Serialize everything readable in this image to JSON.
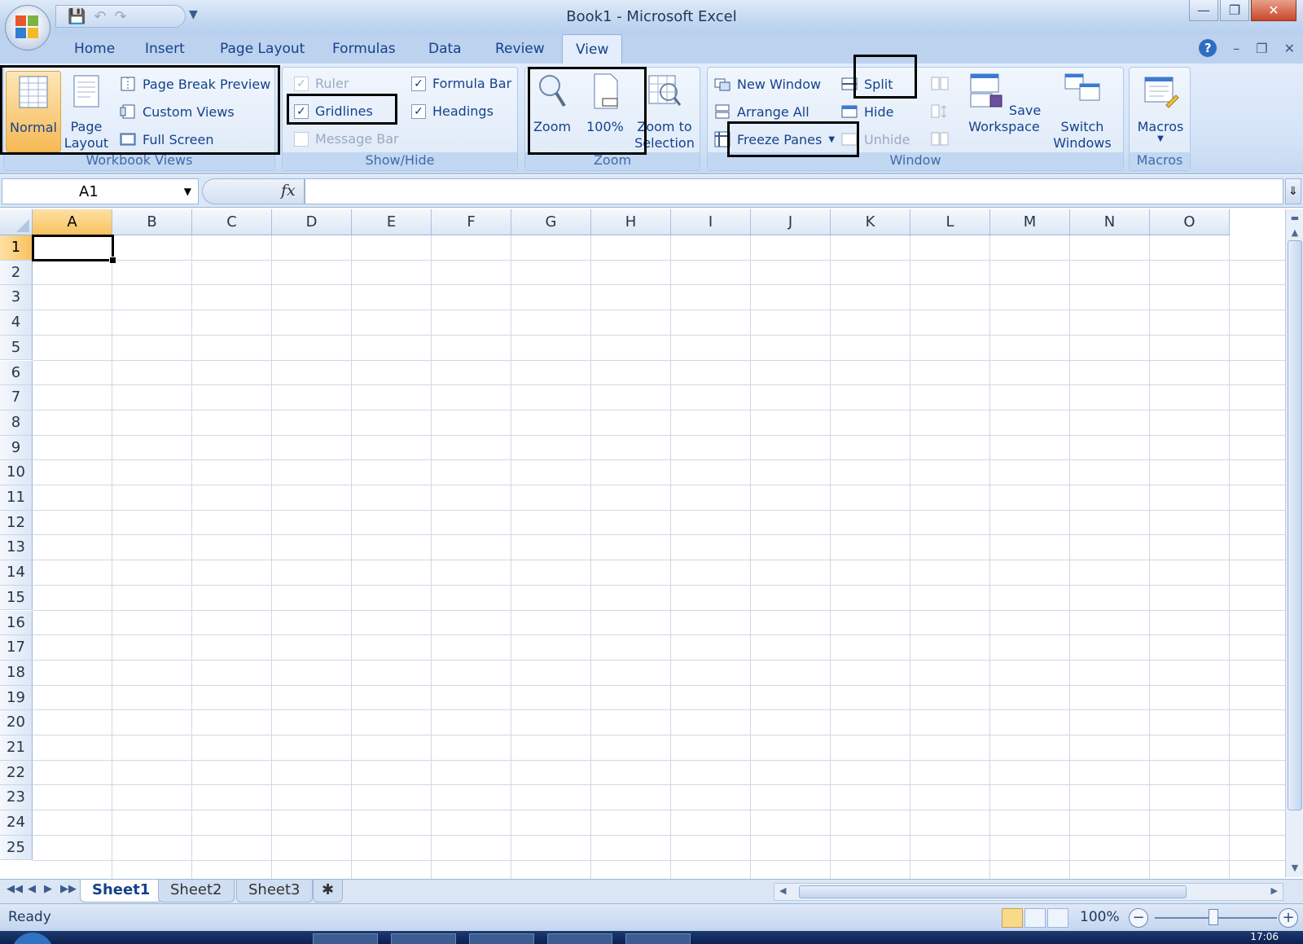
{
  "title": "Book1 - Microsoft Excel",
  "tabs": [
    {
      "label": "Home",
      "active": false
    },
    {
      "label": "Insert",
      "active": false
    },
    {
      "label": "Page Layout",
      "active": false
    },
    {
      "label": "Formulas",
      "active": false
    },
    {
      "label": "Data",
      "active": false
    },
    {
      "label": "Review",
      "active": false
    },
    {
      "label": "View",
      "active": true
    }
  ],
  "ribbon": {
    "workbook_views": {
      "label": "Workbook Views",
      "normal": "Normal",
      "page_layout": "Page\nLayout",
      "page_break_preview": "Page Break Preview",
      "custom_views": "Custom Views",
      "full_screen": "Full Screen"
    },
    "show_hide": {
      "label": "Show/Hide",
      "ruler": {
        "label": "Ruler",
        "checked": true,
        "enabled": false
      },
      "gridlines": {
        "label": "Gridlines",
        "checked": true,
        "enabled": true
      },
      "message_bar": {
        "label": "Message Bar",
        "checked": false,
        "enabled": false
      },
      "formula_bar": {
        "label": "Formula Bar",
        "checked": true,
        "enabled": true
      },
      "headings": {
        "label": "Headings",
        "checked": true,
        "enabled": true
      }
    },
    "zoom": {
      "label": "Zoom",
      "zoom": "Zoom",
      "hundred": "100%",
      "zoom_to_selection": "Zoom to\nSelection"
    },
    "window": {
      "label": "Window",
      "new_window": "New Window",
      "arrange_all": "Arrange All",
      "freeze_panes": "Freeze Panes",
      "split": "Split",
      "hide": "Hide",
      "unhide": "Unhide",
      "save_workspace": "Save\nWorkspace",
      "switch_windows": "Switch\nWindows"
    },
    "macros": {
      "label": "Macros",
      "macros": "Macros"
    }
  },
  "formula_bar": {
    "name_box": "A1",
    "fx": "fx",
    "formula": ""
  },
  "grid": {
    "columns": [
      "A",
      "B",
      "C",
      "D",
      "E",
      "F",
      "G",
      "H",
      "I",
      "J",
      "K",
      "L",
      "M",
      "N",
      "O"
    ],
    "rows": [
      "1",
      "2",
      "3",
      "4",
      "5",
      "6",
      "7",
      "8",
      "9",
      "10",
      "11",
      "12",
      "13",
      "14",
      "15",
      "16",
      "17",
      "18",
      "19",
      "20",
      "21",
      "22",
      "23",
      "24",
      "25"
    ],
    "active_cell": "A1"
  },
  "sheets": [
    {
      "label": "Sheet1",
      "active": true
    },
    {
      "label": "Sheet2",
      "active": false
    },
    {
      "label": "Sheet3",
      "active": false
    }
  ],
  "status": {
    "ready": "Ready",
    "zoom": "100%"
  },
  "taskbar": {
    "clock": "17:06"
  },
  "colors": {
    "accent": "#15428b",
    "active_header": "#f8c15f",
    "highlight_box": "#000000"
  }
}
